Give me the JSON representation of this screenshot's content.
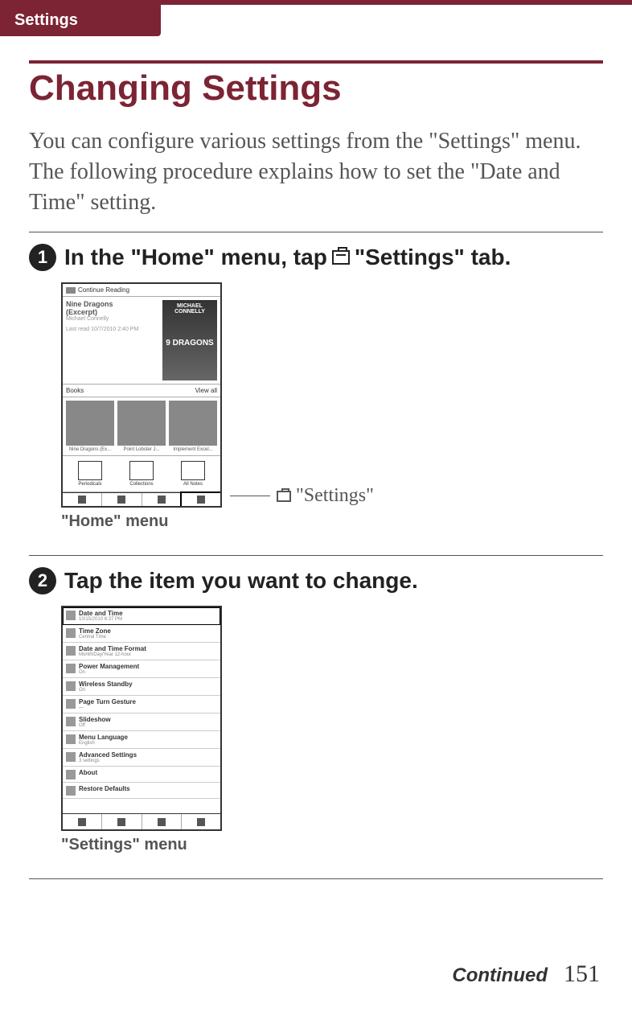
{
  "header": {
    "section": "Settings"
  },
  "title": "Changing Settings",
  "intro": "You can configure various settings from the \"Settings\" menu.\nThe following procedure explains how to set the \"Date and Time\" setting.",
  "step1": {
    "num": "1",
    "text_before": "In the \"Home\" menu, tap",
    "text_after": "\"Settings\" tab.",
    "caption": "\"Home\" menu",
    "callout": "\"Settings\"",
    "home": {
      "top_label": "Continue Reading",
      "book_title": "Nine Dragons",
      "book_sub": "(Excerpt)",
      "author": "Michael Connelly",
      "last": "Last read 10/7/2010 2:40 PM",
      "cover1": "MICHAEL CONNELLY",
      "cover2": "9 DRAGONS",
      "books_label": "Books",
      "books_count": "View all",
      "thumbs": [
        {
          "label": "Nine Dragons (Ex..."
        },
        {
          "label": "Point Lobster J..."
        },
        {
          "label": "Implement Excel..."
        }
      ],
      "icons": [
        {
          "label": "Periodicals"
        },
        {
          "label": "Collections"
        },
        {
          "label": "All Notes"
        }
      ]
    }
  },
  "step2": {
    "num": "2",
    "text": "Tap the item you want to change.",
    "caption": "\"Settings\" menu",
    "items": [
      {
        "title": "Date and Time",
        "sub": "10/15/2010 6:37 PM",
        "hl": true
      },
      {
        "title": "Time Zone",
        "sub": "Central Time"
      },
      {
        "title": "Date and Time Format",
        "sub": "Month/Day/Year 12-hour"
      },
      {
        "title": "Power Management",
        "sub": "On"
      },
      {
        "title": "Wireless Standby",
        "sub": "On"
      },
      {
        "title": "Page Turn Gesture",
        "sub": "—"
      },
      {
        "title": "Slideshow",
        "sub": "Off"
      },
      {
        "title": "Menu Language",
        "sub": "English"
      },
      {
        "title": "Advanced Settings",
        "sub": "3 settings"
      },
      {
        "title": "About",
        "sub": ""
      },
      {
        "title": "Restore Defaults",
        "sub": ""
      }
    ]
  },
  "footer": {
    "continued": "Continued",
    "page": "151"
  }
}
